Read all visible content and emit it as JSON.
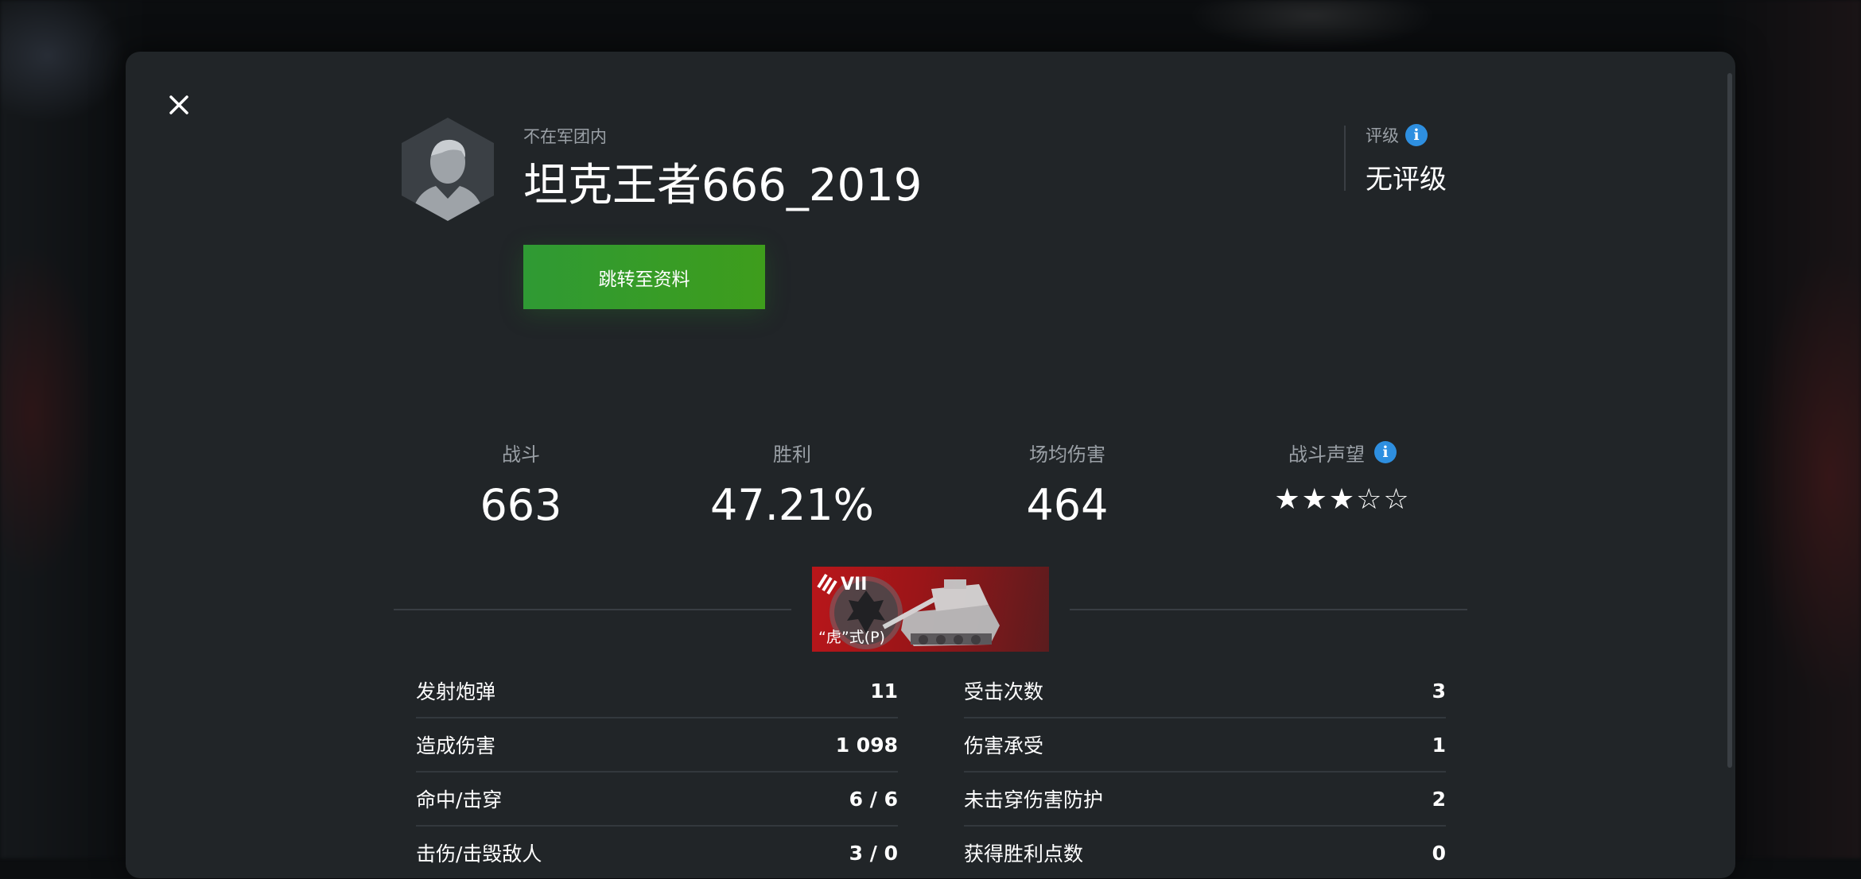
{
  "player": {
    "clan_status": "不在军团内",
    "name": "坦克王者666_2019",
    "profile_button": "跳转至资料"
  },
  "rating": {
    "label": "评级",
    "value": "无评级"
  },
  "summary": {
    "battles_label": "战斗",
    "battles_value": "663",
    "wins_label": "胜利",
    "wins_value": "47.21%",
    "avg_damage_label": "场均伤害",
    "avg_damage_value": "464",
    "reputation_label": "战斗声望",
    "reputation_stars": "★★★☆☆",
    "reputation_level": 3,
    "reputation_max": 5
  },
  "tank": {
    "tier": "VII",
    "name": "“虎”式(P)",
    "card_color": "#b9161a"
  },
  "battle_stats": {
    "left": [
      {
        "label": "发射炮弹",
        "value": "11"
      },
      {
        "label": "造成伤害",
        "value": "1 098"
      },
      {
        "label": "命中/击穿",
        "value": "6 / 6"
      },
      {
        "label": "击伤/击毁敌人",
        "value": "3 / 0"
      }
    ],
    "right": [
      {
        "label": "受击次数",
        "value": "3"
      },
      {
        "label": "伤害承受",
        "value": "1"
      },
      {
        "label": "未击穿伤害防护",
        "value": "2"
      },
      {
        "label": "获得胜利点数",
        "value": "0"
      }
    ]
  },
  "colors": {
    "accent_green": "#3e9d1c",
    "info_blue": "#2e8fe0",
    "panel": "#212528"
  }
}
